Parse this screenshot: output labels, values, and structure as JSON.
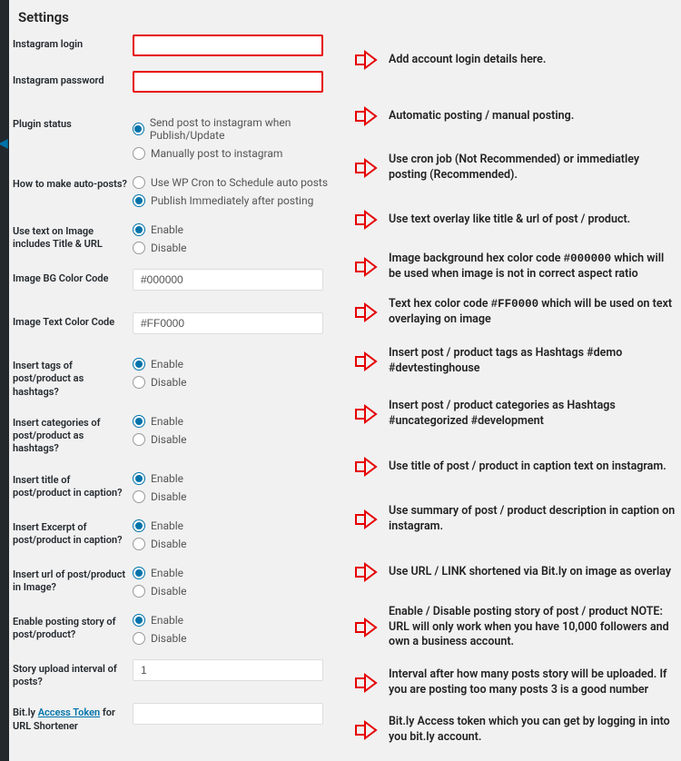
{
  "title": "Settings",
  "fields": {
    "login_label": "Instagram login",
    "login_value": "",
    "password_label": "Instagram password",
    "password_value": "",
    "plugin_status_label": "Plugin status",
    "plugin_status": {
      "opt1": "Send post to instagram when Publish/Update",
      "opt2": "Manually post to instagram",
      "selected": 1
    },
    "autoposts_label": "How to make auto-posts?",
    "autoposts": {
      "opt1": "Use WP Cron to Schedule auto posts",
      "opt2": "Publish Immediately after posting",
      "selected": 2
    },
    "text_on_image_label": "Use text on Image includes Title & URL",
    "enable_disable": {
      "enable": "Enable",
      "disable": "Disable"
    },
    "text_on_image_selected": 1,
    "bgcolor_label": "Image BG Color Code",
    "bgcolor_value": "#000000",
    "textcolor_label": "Image Text Color Code",
    "textcolor_value": "#FF0000",
    "tags_label": "Insert tags of post/product as hashtags?",
    "tags_selected": 1,
    "cats_label": "Insert categories of post/product as hashtags?",
    "cats_selected": 1,
    "title_caption_label": "Insert title of post/product in caption?",
    "title_caption_selected": 1,
    "excerpt_label": "Insert Excerpt of post/product in caption?",
    "excerpt_selected": 1,
    "url_image_label": "Insert url of post/product in Image?",
    "url_image_selected": 1,
    "story_label": "Enable posting story of post/product?",
    "story_selected": 1,
    "story_interval_label": "Story upload interval of posts?",
    "story_interval_value": "1",
    "bitly_prefix": "Bit.ly ",
    "bitly_link": "Access Token",
    "bitly_suffix": " for URL Shortener",
    "bitly_value": ""
  },
  "notes": {
    "login": "Add account login details here.",
    "plugin_status": "Automatic posting / manual posting.",
    "autoposts": "Use cron job (Not Recommended) or immediatley posting (Recommended).",
    "text_on_image": "Use text overlay like title & url of post / product.",
    "bgcolor_a": "Image background hex color code ",
    "bgcolor_b": "#000000",
    "bgcolor_c": " which will be used when image is not in correct aspect ratio",
    "textcolor_a": "Text hex color code ",
    "textcolor_b": "#FF0000",
    "textcolor_c": " which will be used on text overlaying on image",
    "tags": "Insert post / product tags as Hashtags #demo #devtestinghouse",
    "cats": "Insert post / product categories as Hashtags #uncategorized #development",
    "title_caption": "Use title of post / product in caption text on instagram.",
    "excerpt": "Use summary of post / product description in caption on instagram.",
    "url_image": "Use URL / LINK shortened via Bit.ly on image as overlay",
    "story": "Enable / Disable posting story of post / product NOTE: URL will only work when you have 10,000 followers and own a business account.",
    "story_interval": "Interval after how many posts story will be uploaded. If you are posting too many posts 3 is a good number",
    "bitly": "Bit.ly Access token which you can get by logging in into you bit.ly account."
  }
}
